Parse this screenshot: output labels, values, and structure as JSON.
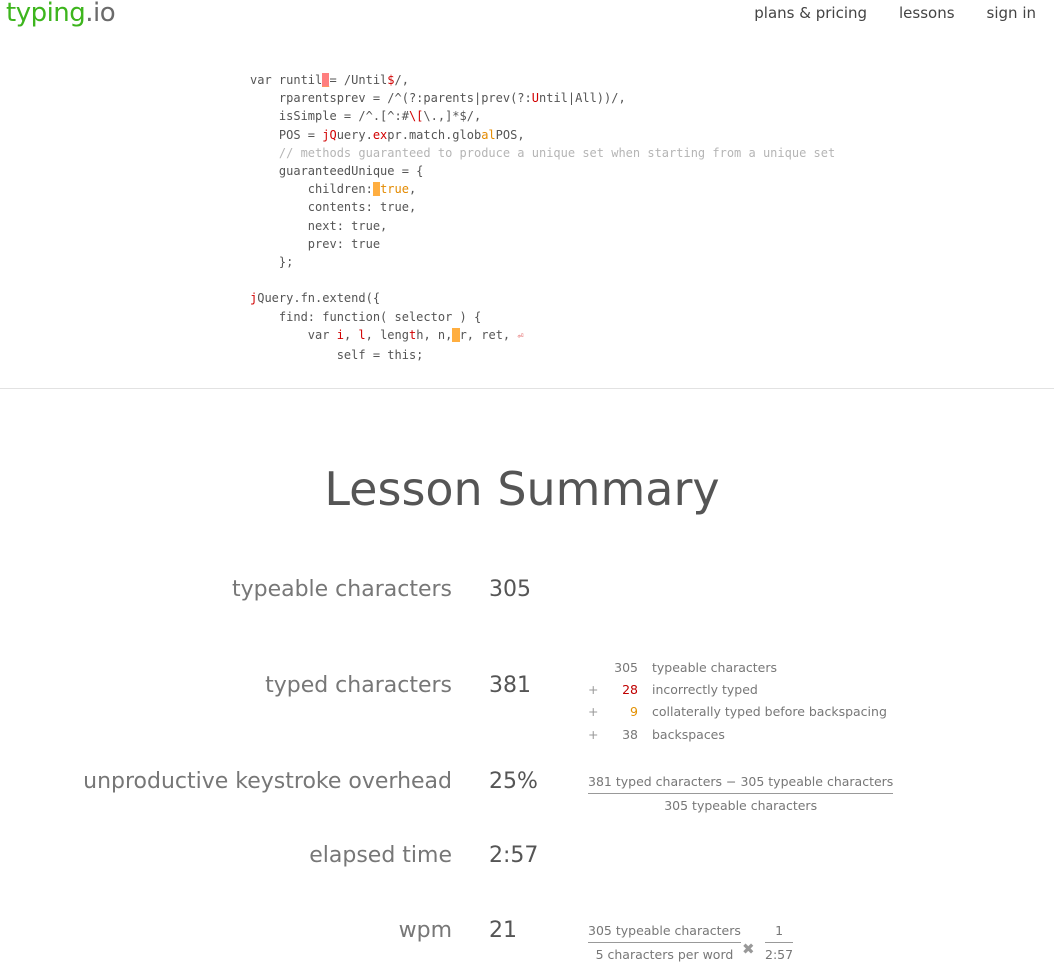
{
  "header": {
    "logo_main": "typing",
    "logo_suffix": ".io",
    "nav": [
      "plans & pricing",
      "lessons",
      "sign in"
    ]
  },
  "code_lines": {
    "l1a": "var runtil",
    "l1b": "= /Until",
    "l1c": "$",
    "l1d": "/,",
    "l2a": "    rparentsprev = /^(?:parents|prev(?:",
    "l2b": "U",
    "l2c": "ntil|All))/,",
    "l3a": "    isSimple = /^.[^:#",
    "l3b": "\\[",
    "l3c": "\\.,]*$/,",
    "l4a": "    POS = ",
    "l4b": "jQ",
    "l4c": "uery.",
    "l4d": "ex",
    "l4e": "pr.match.glob",
    "l4f": "al",
    "l4g": "POS,",
    "l5": "    // methods guaranteed to produce a unique set when starting from a unique set",
    "l6": "    guaranteedUnique = {",
    "l7a": "        children:",
    "l7b": "tru",
    "l7c": "e",
    "l7d": ",",
    "l8": "        contents: true,",
    "l9": "        next: true,",
    "l10": "        prev: true",
    "l11": "    };",
    "l13a": "j",
    "l13b": "Query.fn.extend({",
    "l14": "    find: function( selector ) {",
    "l15a": "        var ",
    "l15b": "i",
    "l15c": ", ",
    "l15d": "l",
    "l15e": ", leng",
    "l15f": "t",
    "l15g": "h, n,",
    "l15h": "r, ret, ",
    "l15i": "⏎",
    "l16": "            self = this;"
  },
  "summary": {
    "title": "Lesson Summary",
    "typeable_label": "typeable characters",
    "typeable_value": "305",
    "typed_label": "typed characters",
    "typed_value": "381",
    "overhead_label": "unproductive keystroke overhead",
    "overhead_value": "25%",
    "elapsed_label": "elapsed time",
    "elapsed_value": "2:57",
    "wpm_label": "wpm",
    "wpm_value": "21"
  },
  "breakdown": [
    {
      "op": "",
      "num": "305",
      "text": "typeable characters",
      "color": "normal"
    },
    {
      "op": "+",
      "num": "28",
      "text": "incorrectly typed",
      "color": "#c00000"
    },
    {
      "op": "+",
      "num": "9",
      "text": "collaterally typed before backspacing",
      "color": "#e39000"
    },
    {
      "op": "+",
      "num": "38",
      "text": "backspaces",
      "color": "normal"
    }
  ],
  "overhead_formula": {
    "numerator": "381 typed characters − 305 typeable characters",
    "denominator": "305 typeable characters"
  },
  "wpm_formula": {
    "f1_num": "305 typeable characters",
    "f1_den": "5 characters per word",
    "times": "✖",
    "f2_num": "1",
    "f2_den": "2:57"
  },
  "colors": {
    "logo_green": "#3db51d",
    "error_red": "#c00000",
    "collateral_orange": "#e39000",
    "cursor": "#ffae40"
  }
}
